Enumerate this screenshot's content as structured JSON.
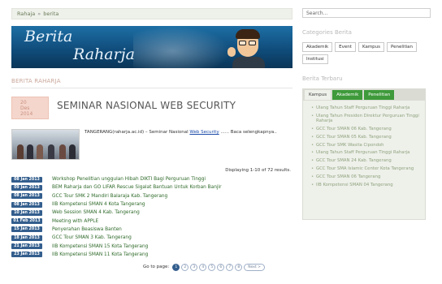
{
  "breadcrumb": {
    "home": "Rahaja",
    "sep": "»",
    "current": "berita"
  },
  "banner": {
    "line1": "Berita",
    "line2": "Raharja"
  },
  "section_title": "BERITA RAHARJA",
  "article": {
    "date_day": "20",
    "date_month": "Des",
    "date_year": "2014",
    "title": "SEMINAR NASIONAL WEB SECURITY",
    "excerpt_prefix": "TANGERANG(raharja.ac.id) – Seminar Nasional ",
    "excerpt_link": "Web Security",
    "excerpt_suffix": " ...... Baca selengkapnya.."
  },
  "results_text": "Displaying 1-10 of 72 results.",
  "news": [
    {
      "date": "08 Jan 2013",
      "title": "Workshop Penelitian unggulan Hibah DIKTI Bagi Perguruan Tinggi"
    },
    {
      "date": "09 Jan 2013",
      "title": "BEM Raharja dan GO LIFAR Rescue Sigalat Bantuan Untuk Korban Banjir"
    },
    {
      "date": "08 Jan 2013",
      "title": "GCC Tour SMK 2 Mandiri Balaraja Kab. Tangerang"
    },
    {
      "date": "08 Jan 2013",
      "title": "IIB Kompetensi SMAN 4 Kota Tangerang"
    },
    {
      "date": "10 Jan 2013",
      "title": "Web Session SMAN 4 Kab. Tangerang"
    },
    {
      "date": "01 Feb 2013",
      "title": "Meeting with APPLE"
    },
    {
      "date": "15 Jan 2013",
      "title": "Penyerahan Beasiswa Banten"
    },
    {
      "date": "18 Jan 2013",
      "title": "GCC Tour SMAN 3 Kab. Tangerang"
    },
    {
      "date": "21 Jan 2013",
      "title": "IIB Kompetensi SMAN 15 Kota Tangerang"
    },
    {
      "date": "23 Jan 2013",
      "title": "IIB Kompetensi SMAN 11 Kota Tangerang"
    }
  ],
  "pager": {
    "label": "Go to page:",
    "pages": [
      "1",
      "2",
      "3",
      "4",
      "5",
      "6",
      "7",
      "8"
    ],
    "next": "Next >"
  },
  "sidebar": {
    "search_placeholder": "Search...",
    "categories_title": "Categories Berita",
    "categories": [
      "Akademik",
      "Event",
      "Kampus",
      "Penelitian",
      "Institusi"
    ],
    "latest_title": "Berita Terbaru",
    "tabs": [
      "Kampus",
      "Akademik",
      "Penelitian"
    ],
    "latest": [
      "Ulang Tahun Staff Perguruan Tinggi Raharja",
      "Ulang Tahun Presiden Direktur Perguruan Tinggi Raharja",
      "GCC Tour SMAN 06 Kab. Tangerang",
      "GCC Tour SMAN 05 Kab. Tangerang",
      "GCC Tour SMK Wasita Cipondoh",
      "Ulang Tahun Staff Perguruan Tinggi Raharja",
      "GCC Tour SMAN 24 Kab. Tangerang",
      "GCC Tour SMA Islamic Center Kota Tangerang",
      "GCC Tour SMAN 06 Tangerang",
      "IIB Kompetensi SMAN 04 Tangerang"
    ]
  }
}
